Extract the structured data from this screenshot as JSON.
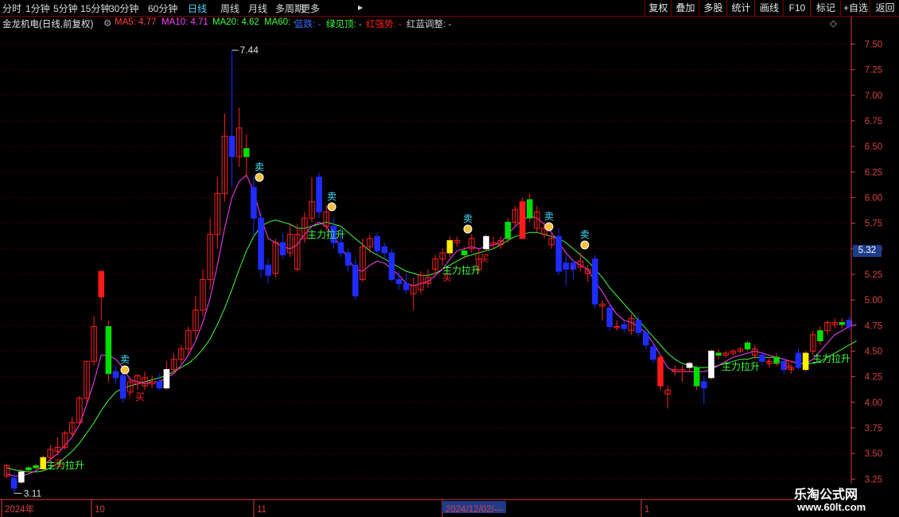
{
  "toolbar": {
    "periods": [
      "分时",
      "1分钟",
      "5分钟",
      "15分钟",
      "30分钟",
      "60分钟",
      "日线",
      "周线",
      "月线",
      "多周期",
      "更多"
    ],
    "active_period": "日线",
    "more_arrow": "▸",
    "right_buttons": [
      "复权",
      "叠加",
      "多股",
      "统计",
      "画线",
      "F10",
      "标记",
      "+自选",
      "返回"
    ]
  },
  "infobar": {
    "title": "金龙机电(日线,前复权)",
    "ma5": "MA5: 4.77",
    "ma10": "MA10: 4.71",
    "ma20": "MA20: 4.62",
    "ma60": "MA60: -",
    "blue_drop": "蓝跌: -",
    "green_top": "绿见顶: -",
    "red_strong": "红强势: -",
    "red_blue_adjust": "红蓝调整: -"
  },
  "colors": {
    "up": "#ff2020",
    "down": "#1e2cff",
    "bull_strong": "#ff1a1a",
    "green_signal": "#00dd00",
    "yellow_signal": "#ffee00",
    "white_signal": "#ffffff",
    "ma_short": "#ff40ff",
    "ma_long": "#40ff40",
    "axis": "#d84040"
  },
  "chart_data": {
    "type": "candlestick",
    "ylim": [
      3.05,
      7.62
    ],
    "yticks": [
      "7.50",
      "7.25",
      "7.00",
      "6.75",
      "6.50",
      "6.25",
      "6.00",
      "5.75",
      "5.50",
      "5.25",
      "5.00",
      "4.75",
      "4.50",
      "4.25",
      "4.00",
      "3.75",
      "3.50",
      "3.25"
    ],
    "x_labels": [
      "2024年",
      "10",
      "11",
      "2024/12/02/—",
      "1"
    ],
    "high_label": "7.44",
    "low_label": "3.11",
    "current_price": "5.32",
    "candles": [
      {
        "o": 3.38,
        "h": 3.4,
        "c": 3.28,
        "l": 3.26,
        "k": "up"
      },
      {
        "o": 3.26,
        "h": 3.3,
        "c": 3.16,
        "l": 3.11,
        "k": "down"
      },
      {
        "o": 3.22,
        "h": 3.35,
        "c": 3.32,
        "l": 3.2,
        "k": "white"
      },
      {
        "o": 3.34,
        "h": 3.38,
        "c": 3.36,
        "l": 3.32,
        "k": "green"
      },
      {
        "o": 3.36,
        "h": 3.4,
        "c": 3.38,
        "l": 3.34,
        "k": "green"
      },
      {
        "o": 3.35,
        "h": 3.48,
        "c": 3.46,
        "l": 3.33,
        "k": "yellow"
      },
      {
        "o": 3.46,
        "h": 3.58,
        "c": 3.54,
        "l": 3.44,
        "k": "up"
      },
      {
        "o": 3.52,
        "h": 3.66,
        "c": 3.56,
        "l": 3.48,
        "k": "up"
      },
      {
        "o": 3.56,
        "h": 3.72,
        "c": 3.7,
        "l": 3.54,
        "k": "up"
      },
      {
        "o": 3.7,
        "h": 3.86,
        "c": 3.8,
        "l": 3.66,
        "k": "up"
      },
      {
        "o": 3.8,
        "h": 4.06,
        "c": 4.04,
        "l": 3.78,
        "k": "up"
      },
      {
        "o": 4.04,
        "h": 4.4,
        "c": 4.4,
        "l": 4.0,
        "k": "up"
      },
      {
        "o": 4.4,
        "h": 4.84,
        "c": 4.74,
        "l": 4.36,
        "k": "up"
      },
      {
        "o": 5.03,
        "h": 5.28,
        "c": 5.28,
        "l": 4.8,
        "k": "bull"
      },
      {
        "o": 4.74,
        "h": 4.8,
        "c": 4.28,
        "l": 4.2,
        "k": "green"
      },
      {
        "o": 4.3,
        "h": 4.36,
        "c": 4.24,
        "l": 4.18,
        "k": "down"
      },
      {
        "o": 4.26,
        "h": 4.34,
        "c": 4.04,
        "l": 4.0,
        "k": "down"
      },
      {
        "o": 4.1,
        "h": 4.24,
        "c": 4.2,
        "l": 4.08,
        "k": "up"
      },
      {
        "o": 4.18,
        "h": 4.28,
        "c": 4.26,
        "l": 4.12,
        "k": "up"
      },
      {
        "o": 4.24,
        "h": 4.3,
        "c": 4.16,
        "l": 4.12,
        "k": "up"
      },
      {
        "o": 4.18,
        "h": 4.26,
        "c": 4.2,
        "l": 4.14,
        "k": "up"
      },
      {
        "o": 4.2,
        "h": 4.28,
        "c": 4.14,
        "l": 4.12,
        "k": "down"
      },
      {
        "o": 4.14,
        "h": 4.4,
        "c": 4.32,
        "l": 4.12,
        "k": "white"
      },
      {
        "o": 4.32,
        "h": 4.48,
        "c": 4.42,
        "l": 4.28,
        "k": "up"
      },
      {
        "o": 4.42,
        "h": 4.56,
        "c": 4.52,
        "l": 4.38,
        "k": "up"
      },
      {
        "o": 4.52,
        "h": 4.74,
        "c": 4.7,
        "l": 4.46,
        "k": "up"
      },
      {
        "o": 4.7,
        "h": 5.04,
        "c": 4.9,
        "l": 4.62,
        "k": "up"
      },
      {
        "o": 4.9,
        "h": 5.3,
        "c": 5.2,
        "l": 4.84,
        "k": "up"
      },
      {
        "o": 5.2,
        "h": 5.8,
        "c": 5.64,
        "l": 5.1,
        "k": "up"
      },
      {
        "o": 5.64,
        "h": 6.2,
        "c": 6.04,
        "l": 5.5,
        "k": "up"
      },
      {
        "o": 6.04,
        "h": 6.82,
        "c": 6.6,
        "l": 5.96,
        "k": "up"
      },
      {
        "o": 6.6,
        "h": 7.44,
        "c": 6.4,
        "l": 6.1,
        "k": "down"
      },
      {
        "o": 6.4,
        "h": 6.88,
        "c": 6.68,
        "l": 6.3,
        "k": "up"
      },
      {
        "o": 6.48,
        "h": 6.62,
        "c": 6.4,
        "l": 6.2,
        "k": "green"
      },
      {
        "o": 6.1,
        "h": 6.2,
        "c": 5.8,
        "l": 5.62,
        "k": "down"
      },
      {
        "o": 5.8,
        "h": 5.86,
        "c": 5.3,
        "l": 5.22,
        "k": "down"
      },
      {
        "o": 5.34,
        "h": 5.4,
        "c": 5.24,
        "l": 5.16,
        "k": "down"
      },
      {
        "o": 5.26,
        "h": 5.6,
        "c": 5.56,
        "l": 5.22,
        "k": "up"
      },
      {
        "o": 5.56,
        "h": 5.66,
        "c": 5.44,
        "l": 5.4,
        "k": "down"
      },
      {
        "o": 5.46,
        "h": 5.74,
        "c": 5.64,
        "l": 5.42,
        "k": "up"
      },
      {
        "o": 5.64,
        "h": 5.74,
        "c": 5.3,
        "l": 5.28,
        "k": "up"
      },
      {
        "o": 5.6,
        "h": 5.86,
        "c": 5.8,
        "l": 5.56,
        "k": "up"
      },
      {
        "o": 5.8,
        "h": 6.2,
        "c": 5.96,
        "l": 5.76,
        "k": "up"
      },
      {
        "o": 6.2,
        "h": 6.24,
        "c": 5.86,
        "l": 5.8,
        "k": "down"
      },
      {
        "o": 5.86,
        "h": 5.92,
        "c": 5.72,
        "l": 5.68,
        "k": "up"
      },
      {
        "o": 5.72,
        "h": 5.8,
        "c": 5.56,
        "l": 5.5,
        "k": "down"
      },
      {
        "o": 5.56,
        "h": 5.7,
        "c": 5.46,
        "l": 5.42,
        "k": "down"
      },
      {
        "o": 5.46,
        "h": 5.5,
        "c": 5.34,
        "l": 5.28,
        "k": "down"
      },
      {
        "o": 5.34,
        "h": 5.4,
        "c": 5.04,
        "l": 5.0,
        "k": "down"
      },
      {
        "o": 5.2,
        "h": 5.6,
        "c": 5.52,
        "l": 5.18,
        "k": "up"
      },
      {
        "o": 5.52,
        "h": 5.64,
        "c": 5.6,
        "l": 5.46,
        "k": "up"
      },
      {
        "o": 5.62,
        "h": 5.66,
        "c": 5.48,
        "l": 5.44,
        "k": "down"
      },
      {
        "o": 5.52,
        "h": 5.56,
        "c": 5.46,
        "l": 5.4,
        "k": "down"
      },
      {
        "o": 5.46,
        "h": 5.5,
        "c": 5.2,
        "l": 5.18,
        "k": "down"
      },
      {
        "o": 5.2,
        "h": 5.28,
        "c": 5.16,
        "l": 5.1,
        "k": "down"
      },
      {
        "o": 5.16,
        "h": 5.26,
        "c": 5.1,
        "l": 5.06,
        "k": "down"
      },
      {
        "o": 5.14,
        "h": 5.22,
        "c": 5.06,
        "l": 4.9,
        "k": "up"
      },
      {
        "o": 5.1,
        "h": 5.28,
        "c": 5.24,
        "l": 5.06,
        "k": "up"
      },
      {
        "o": 5.22,
        "h": 5.3,
        "c": 5.16,
        "l": 5.12,
        "k": "up"
      },
      {
        "o": 5.3,
        "h": 5.44,
        "c": 5.4,
        "l": 5.26,
        "k": "up"
      },
      {
        "o": 5.4,
        "h": 5.5,
        "c": 5.46,
        "l": 5.34,
        "k": "up"
      },
      {
        "o": 5.46,
        "h": 5.62,
        "c": 5.58,
        "l": 5.42,
        "k": "yellow"
      },
      {
        "o": 5.58,
        "h": 5.62,
        "c": 5.56,
        "l": 5.52,
        "k": "up"
      },
      {
        "o": 5.48,
        "h": 5.52,
        "c": 5.44,
        "l": 5.4,
        "k": "green"
      },
      {
        "o": 5.5,
        "h": 5.64,
        "c": 5.6,
        "l": 5.46,
        "k": "up"
      },
      {
        "o": 5.4,
        "h": 5.5,
        "c": 5.3,
        "l": 5.26,
        "k": "up"
      },
      {
        "o": 5.5,
        "h": 5.64,
        "c": 5.62,
        "l": 5.48,
        "k": "white"
      },
      {
        "o": 5.56,
        "h": 5.62,
        "c": 5.54,
        "l": 5.5,
        "k": "up"
      },
      {
        "o": 5.54,
        "h": 5.62,
        "c": 5.58,
        "l": 5.5,
        "k": "up"
      },
      {
        "o": 5.6,
        "h": 5.8,
        "c": 5.76,
        "l": 5.56,
        "k": "green"
      },
      {
        "o": 5.76,
        "h": 5.92,
        "c": 5.88,
        "l": 5.72,
        "k": "up"
      },
      {
        "o": 5.96,
        "h": 6.0,
        "c": 5.6,
        "l": 5.8,
        "k": "bull"
      },
      {
        "o": 5.8,
        "h": 6.04,
        "c": 5.98,
        "l": 5.76,
        "k": "green"
      },
      {
        "o": 5.86,
        "h": 5.92,
        "c": 5.7,
        "l": 5.66,
        "k": "up"
      },
      {
        "o": 5.7,
        "h": 5.76,
        "c": 5.64,
        "l": 5.6,
        "k": "up"
      },
      {
        "o": 5.6,
        "h": 5.66,
        "c": 5.54,
        "l": 5.5,
        "k": "up"
      },
      {
        "o": 5.62,
        "h": 5.7,
        "c": 5.28,
        "l": 5.24,
        "k": "down"
      },
      {
        "o": 5.36,
        "h": 5.44,
        "c": 5.3,
        "l": 5.14,
        "k": "down"
      },
      {
        "o": 5.36,
        "h": 5.4,
        "c": 5.3,
        "l": 5.2,
        "k": "down"
      },
      {
        "o": 5.38,
        "h": 5.46,
        "c": 5.32,
        "l": 5.28,
        "k": "up"
      },
      {
        "o": 5.3,
        "h": 5.34,
        "c": 5.26,
        "l": 5.18,
        "k": "up"
      },
      {
        "o": 5.4,
        "h": 5.44,
        "c": 4.96,
        "l": 4.92,
        "k": "down"
      },
      {
        "o": 4.96,
        "h": 5.0,
        "c": 4.94,
        "l": 4.8,
        "k": "up"
      },
      {
        "o": 4.92,
        "h": 4.96,
        "c": 4.74,
        "l": 4.7,
        "k": "down"
      },
      {
        "o": 4.74,
        "h": 4.8,
        "c": 4.74,
        "l": 4.7,
        "k": "up"
      },
      {
        "o": 4.76,
        "h": 4.8,
        "c": 4.72,
        "l": 4.68,
        "k": "down"
      },
      {
        "o": 4.7,
        "h": 4.86,
        "c": 4.82,
        "l": 4.66,
        "k": "up"
      },
      {
        "o": 4.8,
        "h": 4.84,
        "c": 4.68,
        "l": 4.64,
        "k": "down"
      },
      {
        "o": 4.68,
        "h": 4.72,
        "c": 4.56,
        "l": 4.52,
        "k": "down"
      },
      {
        "o": 4.54,
        "h": 4.58,
        "c": 4.42,
        "l": 4.38,
        "k": "down"
      },
      {
        "o": 4.44,
        "h": 4.46,
        "c": 4.16,
        "l": 4.12,
        "k": "bull"
      },
      {
        "o": 4.12,
        "h": 4.16,
        "c": 4.08,
        "l": 3.94,
        "k": "up"
      },
      {
        "o": 4.32,
        "h": 4.36,
        "c": 4.3,
        "l": 4.26,
        "k": "up"
      },
      {
        "o": 4.3,
        "h": 4.36,
        "c": 4.32,
        "l": 4.2,
        "k": "up"
      },
      {
        "o": 4.34,
        "h": 4.4,
        "c": 4.38,
        "l": 4.3,
        "k": "white"
      },
      {
        "o": 4.34,
        "h": 4.36,
        "c": 4.16,
        "l": 4.12,
        "k": "green"
      },
      {
        "o": 4.2,
        "h": 4.26,
        "c": 4.14,
        "l": 3.98,
        "k": "down"
      },
      {
        "o": 4.24,
        "h": 4.52,
        "c": 4.5,
        "l": 4.22,
        "k": "white"
      },
      {
        "o": 4.48,
        "h": 4.52,
        "c": 4.46,
        "l": 4.42,
        "k": "green"
      },
      {
        "o": 4.46,
        "h": 4.5,
        "c": 4.48,
        "l": 4.44,
        "k": "up"
      },
      {
        "o": 4.48,
        "h": 4.52,
        "c": 4.5,
        "l": 4.46,
        "k": "up"
      },
      {
        "o": 4.5,
        "h": 4.54,
        "c": 4.52,
        "l": 4.48,
        "k": "up"
      },
      {
        "o": 4.52,
        "h": 4.6,
        "c": 4.58,
        "l": 4.5,
        "k": "green"
      },
      {
        "o": 4.52,
        "h": 4.56,
        "c": 4.46,
        "l": 4.42,
        "k": "up"
      },
      {
        "o": 4.46,
        "h": 4.5,
        "c": 4.4,
        "l": 4.36,
        "k": "down"
      },
      {
        "o": 4.4,
        "h": 4.44,
        "c": 4.38,
        "l": 4.34,
        "k": "up"
      },
      {
        "o": 4.38,
        "h": 4.48,
        "c": 4.44,
        "l": 4.36,
        "k": "green"
      },
      {
        "o": 4.4,
        "h": 4.44,
        "c": 4.32,
        "l": 4.28,
        "k": "down"
      },
      {
        "o": 4.32,
        "h": 4.36,
        "c": 4.34,
        "l": 4.28,
        "k": "up"
      },
      {
        "o": 4.34,
        "h": 4.52,
        "c": 4.48,
        "l": 4.32,
        "k": "down"
      },
      {
        "o": 4.32,
        "h": 4.5,
        "c": 4.48,
        "l": 4.3,
        "k": "yellow"
      },
      {
        "o": 4.5,
        "h": 4.7,
        "c": 4.66,
        "l": 4.46,
        "k": "up"
      },
      {
        "o": 4.6,
        "h": 4.74,
        "c": 4.7,
        "l": 4.56,
        "k": "green"
      },
      {
        "o": 4.7,
        "h": 4.8,
        "c": 4.78,
        "l": 4.66,
        "k": "up"
      },
      {
        "o": 4.78,
        "h": 4.82,
        "c": 4.76,
        "l": 4.72,
        "k": "up"
      },
      {
        "o": 4.76,
        "h": 4.82,
        "c": 4.78,
        "l": 4.72,
        "k": "green"
      },
      {
        "o": 4.8,
        "h": 4.84,
        "c": 4.74,
        "l": 4.7,
        "k": "down"
      }
    ],
    "ma_short": [
      3.3,
      3.28,
      3.28,
      3.3,
      3.33,
      3.38,
      3.44,
      3.5,
      3.58,
      3.66,
      3.78,
      3.98,
      4.2,
      4.46,
      4.46,
      4.42,
      4.34,
      4.22,
      4.2,
      4.18,
      4.2,
      4.2,
      4.24,
      4.28,
      4.36,
      4.46,
      4.6,
      4.78,
      5.02,
      5.34,
      5.7,
      6.0,
      6.16,
      6.22,
      6.06,
      5.8,
      5.6,
      5.56,
      5.52,
      5.5,
      5.54,
      5.64,
      5.72,
      5.76,
      5.72,
      5.62,
      5.52,
      5.4,
      5.3,
      5.28,
      5.34,
      5.38,
      5.36,
      5.3,
      5.24,
      5.16,
      5.14,
      5.16,
      5.18,
      5.24,
      5.3,
      5.4,
      5.48,
      5.5,
      5.52,
      5.5,
      5.52,
      5.54,
      5.56,
      5.64,
      5.72,
      5.78,
      5.82,
      5.8,
      5.74,
      5.66,
      5.56,
      5.46,
      5.38,
      5.34,
      5.3,
      5.18,
      5.08,
      4.96,
      4.86,
      4.8,
      4.78,
      4.74,
      4.68,
      4.58,
      4.46,
      4.34,
      4.3,
      4.3,
      4.3,
      4.3,
      4.3,
      4.32,
      4.36,
      4.4,
      4.44,
      4.46,
      4.48,
      4.5,
      4.48,
      4.46,
      4.44,
      4.42,
      4.4,
      4.38,
      4.38,
      4.42,
      4.5,
      4.58,
      4.66,
      4.7,
      4.74,
      4.76
    ],
    "ma_long": [
      3.36,
      3.34,
      3.33,
      3.32,
      3.32,
      3.33,
      3.36,
      3.4,
      3.46,
      3.52,
      3.6,
      3.7,
      3.8,
      3.92,
      4.02,
      4.1,
      4.14,
      4.16,
      4.18,
      4.2,
      4.22,
      4.24,
      4.26,
      4.3,
      4.34,
      4.38,
      4.44,
      4.52,
      4.62,
      4.76,
      4.92,
      5.1,
      5.3,
      5.48,
      5.62,
      5.72,
      5.76,
      5.78,
      5.76,
      5.74,
      5.7,
      5.7,
      5.72,
      5.74,
      5.76,
      5.74,
      5.72,
      5.66,
      5.6,
      5.54,
      5.48,
      5.44,
      5.4,
      5.36,
      5.32,
      5.28,
      5.26,
      5.24,
      5.24,
      5.26,
      5.3,
      5.34,
      5.38,
      5.42,
      5.44,
      5.46,
      5.48,
      5.5,
      5.54,
      5.58,
      5.62,
      5.64,
      5.66,
      5.66,
      5.64,
      5.62,
      5.6,
      5.56,
      5.5,
      5.44,
      5.38,
      5.3,
      5.22,
      5.12,
      5.04,
      4.96,
      4.88,
      4.8,
      4.72,
      4.64,
      4.56,
      4.48,
      4.42,
      4.38,
      4.36,
      4.34,
      4.34,
      4.34,
      4.36,
      4.38,
      4.4,
      4.42,
      4.42,
      4.44,
      4.44,
      4.44,
      4.44,
      4.42,
      4.4,
      4.38,
      4.38,
      4.38,
      4.4,
      4.44,
      4.48,
      4.52,
      4.56,
      4.6
    ]
  },
  "annotations": {
    "sell": "卖",
    "buy": "买",
    "main_force": "主力拉升",
    "arrow": "↑"
  },
  "watermark": {
    "line1": "乐淘公式网",
    "line2": "www.60lt.com"
  },
  "controls": {
    "diamond": "◇",
    "settings": "⚙"
  }
}
